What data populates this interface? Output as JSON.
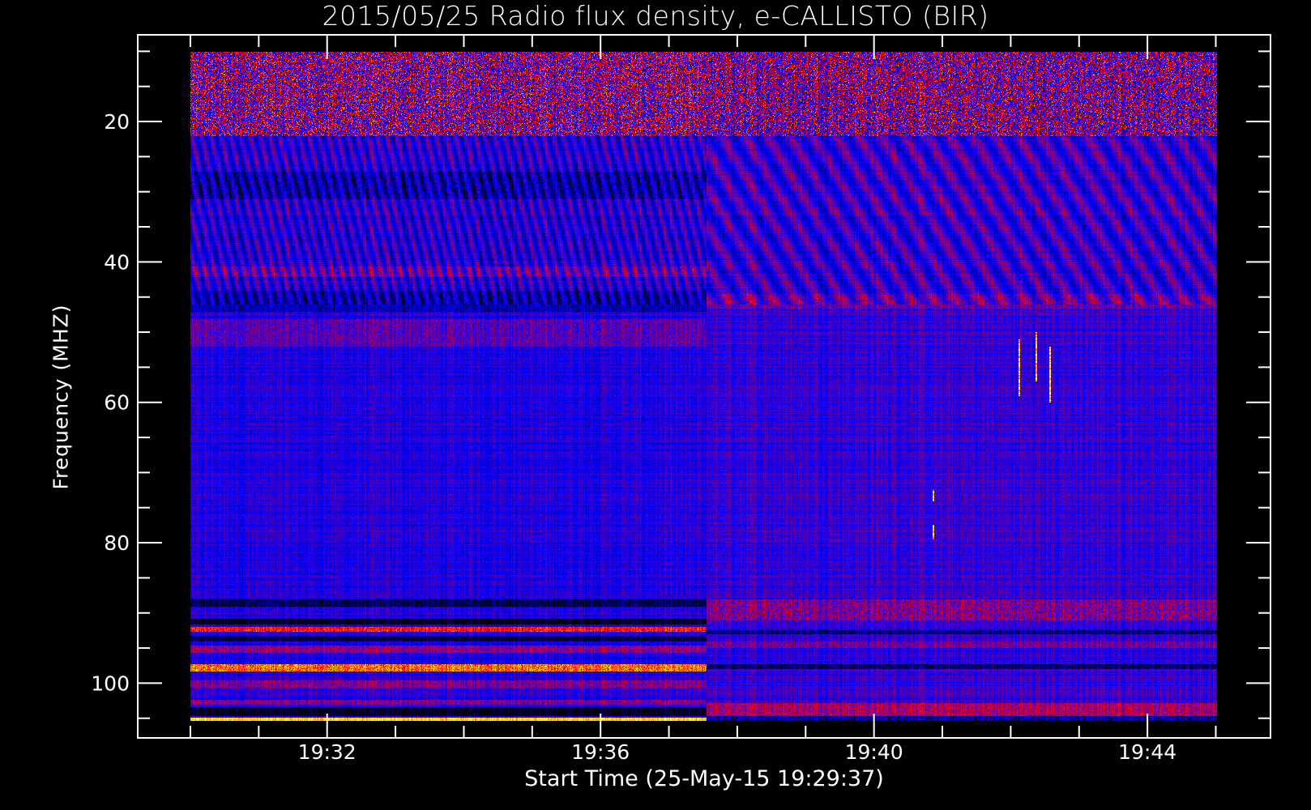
{
  "chart_data": {
    "type": "heatmap",
    "title": "2015/05/25  Radio flux density, e-CALLISTO (BIR)",
    "xlabel": "Start Time (25-May-15 19:29:37)",
    "ylabel": "Frequency (MHZ)",
    "x_units": "minutes after 19:30:00",
    "xlim_data": [
      0,
      15
    ],
    "xlim_axis": [
      -0.77,
      15.8
    ],
    "x_ticks": [
      {
        "value": 2,
        "label": "19:32"
      },
      {
        "value": 6,
        "label": "19:36"
      },
      {
        "value": 10,
        "label": "19:40"
      },
      {
        "value": 14,
        "label": "19:44"
      }
    ],
    "x_minor_step": 1,
    "ylim_data": [
      10,
      105.4
    ],
    "ylim_axis": [
      7.65,
      107.8
    ],
    "y_inverted": true,
    "y_ticks": [
      {
        "value": 20,
        "label": "20"
      },
      {
        "value": 40,
        "label": "40"
      },
      {
        "value": 60,
        "label": "60"
      },
      {
        "value": 80,
        "label": "80"
      },
      {
        "value": 100,
        "label": "100"
      }
    ],
    "y_minor_step": 5,
    "colormap": [
      "#000000",
      "#0000ff",
      "#7a0090",
      "#ff0000",
      "#ff9900",
      "#ffff00",
      "#ffffff"
    ],
    "segment_switch_minute": 7.53,
    "base_level": 0.34,
    "bands_before_switch": [
      {
        "f0": 10,
        "f1": 22,
        "level": 0.5,
        "noise": 0.3
      },
      {
        "f0": 27,
        "f1": 31,
        "level": 0.22,
        "noise": 0.12
      },
      {
        "f0": 40.5,
        "f1": 42,
        "level": 0.45,
        "noise": 0.1
      },
      {
        "f0": 44,
        "f1": 47,
        "level": 0.22,
        "noise": 0.1
      },
      {
        "f0": 48,
        "f1": 52,
        "level": 0.44,
        "noise": 0.1
      },
      {
        "f0": 88,
        "f1": 89,
        "level": 0.1,
        "noise": 0.1
      },
      {
        "f0": 90.8,
        "f1": 91.6,
        "level": 0.04,
        "noise": 0.03
      },
      {
        "f0": 92,
        "f1": 92.6,
        "level": 0.68,
        "noise": 0.1
      },
      {
        "f0": 93.2,
        "f1": 94,
        "level": 0.08,
        "noise": 0.05
      },
      {
        "f0": 94.6,
        "f1": 95.6,
        "level": 0.52,
        "noise": 0.1
      },
      {
        "f0": 97.3,
        "f1": 98.3,
        "level": 0.78,
        "noise": 0.12
      },
      {
        "f0": 99.6,
        "f1": 100.6,
        "level": 0.5,
        "noise": 0.1
      },
      {
        "f0": 102.3,
        "f1": 103,
        "level": 0.5,
        "noise": 0.1
      },
      {
        "f0": 103.4,
        "f1": 104.6,
        "level": 0.04,
        "noise": 0.03
      },
      {
        "f0": 104.9,
        "f1": 105.4,
        "level": 0.88,
        "noise": 0.06
      }
    ],
    "bands_after_switch": [
      {
        "f0": 10,
        "f1": 22,
        "level": 0.48,
        "noise": 0.3
      },
      {
        "f0": 44.5,
        "f1": 46.5,
        "level": 0.46,
        "noise": 0.1
      },
      {
        "f0": 88,
        "f1": 91,
        "level": 0.5,
        "noise": 0.12
      },
      {
        "f0": 92.4,
        "f1": 93,
        "level": 0.15,
        "noise": 0.1
      },
      {
        "f0": 94,
        "f1": 95,
        "level": 0.48,
        "noise": 0.1
      },
      {
        "f0": 97.2,
        "f1": 98,
        "level": 0.12,
        "noise": 0.08
      },
      {
        "f0": 102.8,
        "f1": 104.6,
        "level": 0.56,
        "noise": 0.1
      },
      {
        "f0": 104.6,
        "f1": 105.4,
        "level": 0.2,
        "noise": 0.15
      }
    ],
    "drifting_stripes": {
      "f0": 22,
      "f1": 46,
      "amplitude": 0.12
    },
    "bursts": [
      {
        "minute": 10.85,
        "f0": 72.5,
        "f1": 74
      },
      {
        "minute": 10.85,
        "f0": 77.5,
        "f1": 79.5
      },
      {
        "minute": 12.1,
        "f0": 51,
        "f1": 59
      },
      {
        "minute": 12.35,
        "f0": 50,
        "f1": 57
      },
      {
        "minute": 12.55,
        "f0": 52,
        "f1": 60
      }
    ]
  }
}
